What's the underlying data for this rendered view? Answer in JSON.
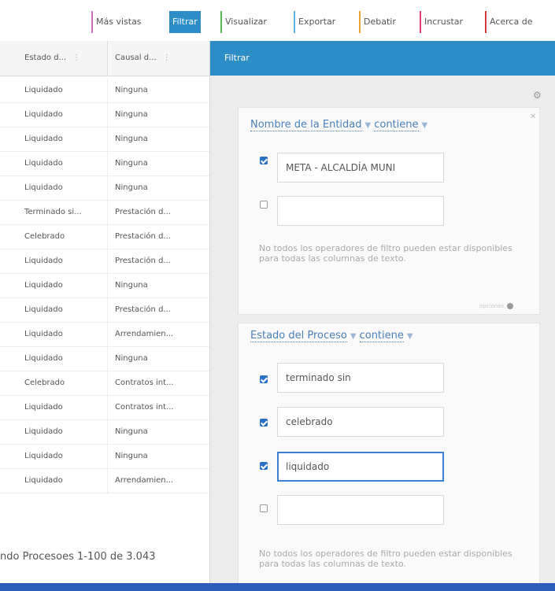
{
  "toolbar": {
    "buttons": [
      {
        "label": "Más vistas",
        "accent": "#c86fc8"
      },
      {
        "label": "Filtrar",
        "accent": "#2d8ec7",
        "active": true
      },
      {
        "label": "Visualizar",
        "accent": "#5ab55a"
      },
      {
        "label": "Exportar",
        "accent": "#5fb6e6"
      },
      {
        "label": "Debatir",
        "accent": "#f0a030"
      },
      {
        "label": "Incrustar",
        "accent": "#e0407a"
      },
      {
        "label": "Acerca de",
        "accent": "#d23a3a"
      }
    ]
  },
  "grid": {
    "columns": [
      {
        "label": "Estado d...",
        "menu": "⋮"
      },
      {
        "label": "Causal d...",
        "menu": "⋮"
      }
    ],
    "rows": [
      [
        "Liquidado",
        "Ninguna"
      ],
      [
        "Liquidado",
        "Ninguna"
      ],
      [
        "Liquidado",
        "Ninguna"
      ],
      [
        "Liquidado",
        "Ninguna"
      ],
      [
        "Liquidado",
        "Ninguna"
      ],
      [
        "Terminado si...",
        "Prestación d..."
      ],
      [
        "Celebrado",
        "Prestación d..."
      ],
      [
        "Liquidado",
        "Prestación d..."
      ],
      [
        "Liquidado",
        "Ninguna"
      ],
      [
        "Liquidado",
        "Prestación d..."
      ],
      [
        "Liquidado",
        "Arrendamien..."
      ],
      [
        "Liquidado",
        "Ninguna"
      ],
      [
        "Celebrado",
        "Contratos int..."
      ],
      [
        "Liquidado",
        "Contratos int..."
      ],
      [
        "Liquidado",
        "Ninguna"
      ],
      [
        "Liquidado",
        "Ninguna"
      ],
      [
        "Liquidado",
        "Arrendamien..."
      ]
    ],
    "footer": "ndo Procesoes 1-100 de 3.043"
  },
  "panel": {
    "title": "Filtrar",
    "filters": [
      {
        "column": "Nombre de la Entidad",
        "operator": "contiene",
        "values": [
          {
            "checked": true,
            "text": "META - ALCALDÍA MUNI"
          },
          {
            "checked": false,
            "text": ""
          }
        ],
        "note": "No todos los operadores de filtro pueden estar disponibles para todas las columnas de texto.",
        "foot": "opciones"
      },
      {
        "column": "Estado del Proceso",
        "operator": "contiene",
        "values": [
          {
            "checked": true,
            "text": "terminado sin"
          },
          {
            "checked": true,
            "text": "celebrado"
          },
          {
            "checked": true,
            "text": "liquidado",
            "focused": true
          },
          {
            "checked": false,
            "text": ""
          }
        ],
        "note": "No todos los operadores de filtro pueden estar disponibles para todas las columnas de texto."
      }
    ]
  }
}
